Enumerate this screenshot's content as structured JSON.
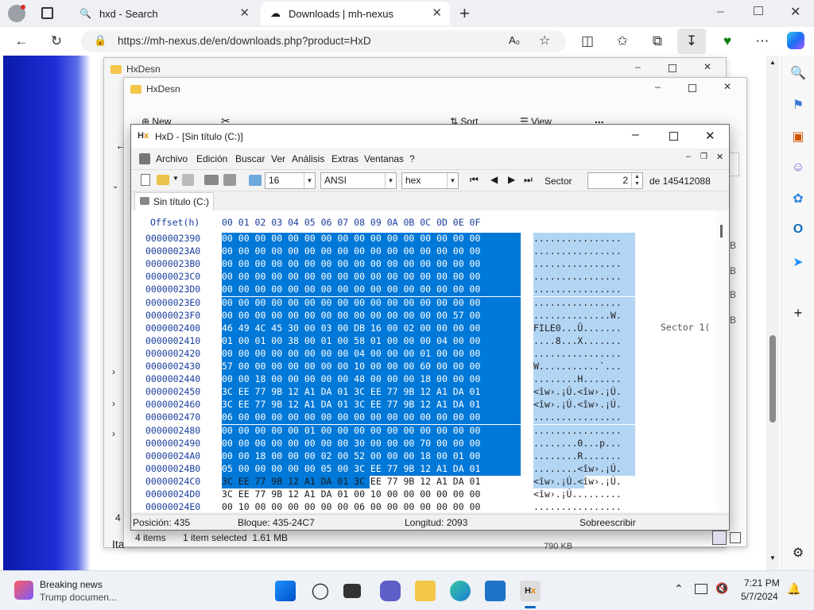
{
  "browser": {
    "tabs": [
      {
        "label": "hxd - Search",
        "icon": "search-icon"
      },
      {
        "label": "Downloads | mh-nexus",
        "icon": "cloud-icon"
      }
    ],
    "url": "https://mh-nexus.de/en/downloads.php?product=HxD"
  },
  "explorer_back": {
    "title": "HxDesn"
  },
  "explorer_front": {
    "title": "HxDesn",
    "toolbar": {
      "new_label": "New",
      "sort_label": "Sort",
      "view_label": "View",
      "more_label": "..."
    },
    "status": {
      "items": "4 items",
      "selected": "1 item selected  1.61 MB"
    },
    "side_partial": [
      "4",
      "Ita"
    ],
    "right_partial_letters": [
      "B",
      "B",
      "B",
      "B"
    ],
    "size_partial": "790 KB"
  },
  "hxd": {
    "title": "HxD - [Sin título (C:)]",
    "menu": [
      "Archivo",
      "Edición",
      "Buscar",
      "Ver",
      "Análisis",
      "Extras",
      "Ventanas",
      "?"
    ],
    "toolbar": {
      "bytes_per_row": "16",
      "charset": "ANSI",
      "offset_base": "hex",
      "sector_label": "Sector",
      "sector_value": "2",
      "sector_total": "de 145412088"
    },
    "doc_tab": "Sin título (C:)",
    "header": {
      "offset": "Offset(h)",
      "cols": "00 01 02 03 04 05 06 07 08 09 0A 0B 0C 0D 0E 0F"
    },
    "side_label": "Sector 1(",
    "rows": [
      {
        "off": "0000002390",
        "hex": "00 00 00 00 00 00 00 00 00 00 00 00 00 00 00 00",
        "txt": "................"
      },
      {
        "off": "00000023A0",
        "hex": "00 00 00 00 00 00 00 00 00 00 00 00 00 00 00 00",
        "txt": "................"
      },
      {
        "off": "00000023B0",
        "hex": "00 00 00 00 00 00 00 00 00 00 00 00 00 00 00 00",
        "txt": "................"
      },
      {
        "off": "00000023C0",
        "hex": "00 00 00 00 00 00 00 00 00 00 00 00 00 00 00 00",
        "txt": "................"
      },
      {
        "off": "00000023D0",
        "hex": "00 00 00 00 00 00 00 00 00 00 00 00 00 00 00 00",
        "txt": "................"
      },
      {
        "off": "00000023E0",
        "hex": "00 00 00 00 00 00 00 00 00 00 00 00 00 00 00 00",
        "txt": "................"
      },
      {
        "off": "00000023F0",
        "hex": "00 00 00 00 00 00 00 00 00 00 00 00 00 00 57 00",
        "txt": "..............W."
      },
      {
        "off": "0000002400",
        "hex": "46 49 4C 45 30 00 03 00 DB 16 00 02 00 00 00 00",
        "txt": "FILE0...Û......."
      },
      {
        "off": "0000002410",
        "hex": "01 00 01 00 38 00 01 00 58 01 00 00 00 04 00 00",
        "txt": "....8...X......."
      },
      {
        "off": "0000002420",
        "hex": "00 00 00 00 00 00 00 00 04 00 00 00 01 00 00 00",
        "txt": "................"
      },
      {
        "off": "0000002430",
        "hex": "57 00 00 00 00 00 00 00 10 00 00 00 60 00 00 00",
        "txt": "W...........`..."
      },
      {
        "off": "0000002440",
        "hex": "00 00 18 00 00 00 00 00 48 00 00 00 18 00 00 00",
        "txt": "........H......."
      },
      {
        "off": "0000002450",
        "hex": "3C EE 77 9B 12 A1 DA 01 3C EE 77 9B 12 A1 DA 01",
        "txt": "<îw›.¡Ú.<îw›.¡Ú."
      },
      {
        "off": "0000002460",
        "hex": "3C EE 77 9B 12 A1 DA 01 3C EE 77 9B 12 A1 DA 01",
        "txt": "<îw›.¡Ú.<îw›.¡Ú."
      },
      {
        "off": "0000002470",
        "hex": "06 00 00 00 00 00 00 00 00 00 00 00 00 00 00 00",
        "txt": "................"
      },
      {
        "off": "0000002480",
        "hex": "00 00 00 00 00 01 00 00 00 00 00 00 00 00 00 00",
        "txt": "................"
      },
      {
        "off": "0000002490",
        "hex": "00 00 00 00 00 00 00 00 30 00 00 00 70 00 00 00",
        "txt": "........0...p..."
      },
      {
        "off": "00000024A0",
        "hex": "00 00 18 00 00 00 02 00 52 00 00 00 18 00 01 00",
        "txt": "........R......."
      },
      {
        "off": "00000024B0",
        "hex": "05 00 00 00 00 00 05 00 3C EE 77 9B 12 A1 DA 01",
        "txt": "........<îw›.¡Ú."
      },
      {
        "off": "00000024C0",
        "hex": "3C EE 77 9B 12 A1 DA 01 3C EE 77 9B 12 A1 DA 01",
        "txt": "<îw›.¡Ú.<îw›.¡Ú."
      },
      {
        "off": "00000024D0",
        "hex": "3C EE 77 9B 12 A1 DA 01 00 10 00 00 00 00 00 00",
        "txt": "<îw›.¡Ú........."
      },
      {
        "off": "00000024E0",
        "hex": "00 10 00 00 00 00 00 00 06 00 00 00 00 00 00 00",
        "txt": "................"
      }
    ],
    "status": {
      "position": "Posición: 435",
      "block": "Bloque: 435-24C7",
      "length": "Longitud: 2093",
      "mode": "Sobreescribir"
    }
  },
  "taskbar": {
    "news_title": "Breaking news",
    "news_sub": "Trump documen...",
    "time": "7:21 PM",
    "date": "5/7/2024"
  },
  "colors": {
    "selection": "#0078d7",
    "text_selection": "#b3d5f4",
    "offset_blue": "#1a3d9e"
  }
}
